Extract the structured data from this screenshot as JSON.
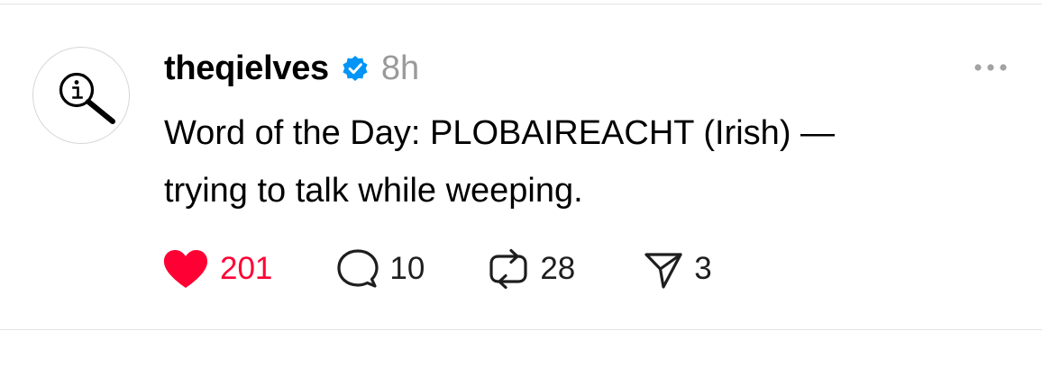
{
  "post": {
    "author": {
      "username": "theqielves",
      "verified": true,
      "avatar_icon": "magnifier-info-icon"
    },
    "timestamp": "8h",
    "text_line1": "Word of the Day: PLOBAIREACHT (Irish) —",
    "text_line2": "trying to talk while weeping.",
    "actions": {
      "likes": "201",
      "replies": "10",
      "reposts": "28",
      "shares": "3"
    },
    "like_state": "liked"
  },
  "colors": {
    "like": "#ff0034",
    "verified": "#0095f6",
    "muted": "#9a9a9a",
    "divider": "#e3e3e3"
  }
}
